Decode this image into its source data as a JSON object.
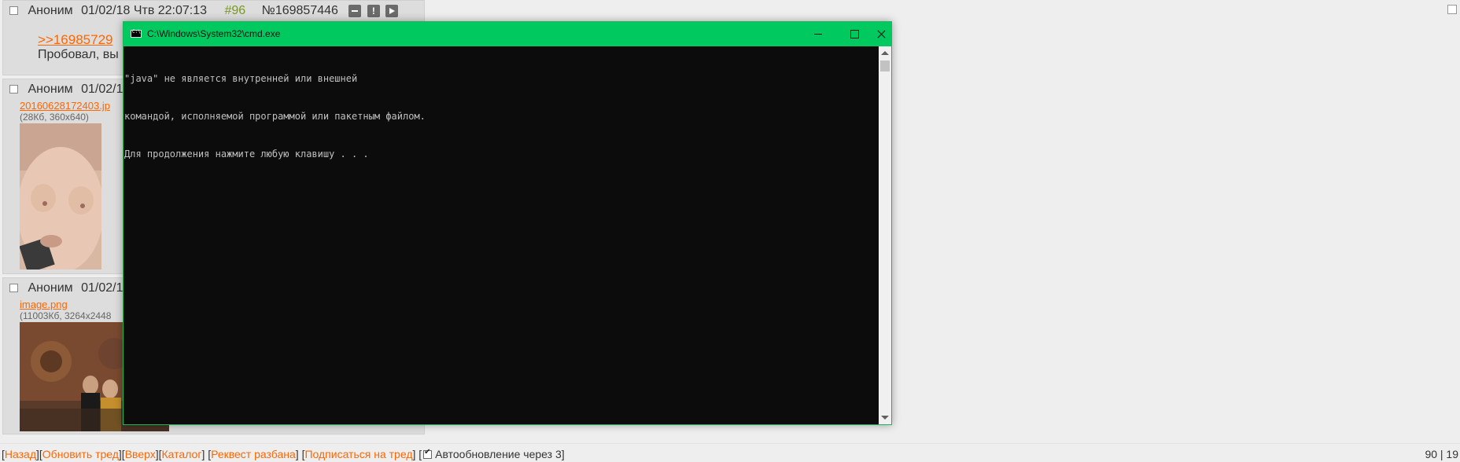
{
  "posts": [
    {
      "name": "Аноним",
      "datetime": "01/02/18 Чтв 22:07:13",
      "number": "#96",
      "id": "№169857446",
      "reply_link": ">>16985729",
      "text": "Пробовал, вы"
    },
    {
      "name": "Аноним",
      "datetime": "01/02/1",
      "file_name": "20160628172403.jp",
      "file_info": "(28Кб, 360x640)"
    },
    {
      "name": "Аноним",
      "datetime": "01/02/1",
      "file_name": "image.png",
      "file_info": "(11003Кб, 3264x2448"
    }
  ],
  "cmd": {
    "title": "C:\\Windows\\System32\\cmd.exe",
    "lines": [
      "\"java\" не является внутренней или внешней",
      "командой, исполняемой программой или пакетным файлом.",
      "Для продолжения нажмите любую клавишу . . ."
    ]
  },
  "bottombar": {
    "back": "Назад",
    "refresh": "Обновить тред",
    "up": "Вверх",
    "catalog": "Каталог",
    "request": "Реквест разбана",
    "subscribe": "Подписаться на тред",
    "autoupdate": "Автообновление через 3",
    "counter": "90 | 19"
  },
  "colors": {
    "accent_link": "#ff6600",
    "cmd_titlebar": "#00c95f",
    "post_bg": "#dddddd",
    "page_bg": "#eeeeee"
  }
}
